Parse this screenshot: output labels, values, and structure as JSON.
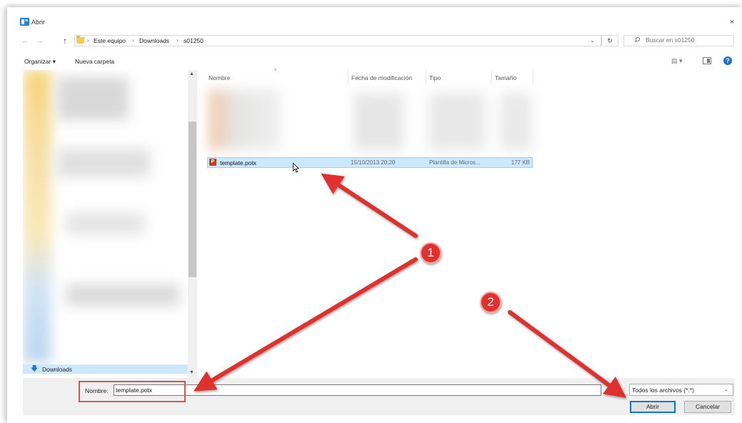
{
  "window": {
    "title": "Abrir",
    "close": "×"
  },
  "nav": {
    "back": "←",
    "forward": "→",
    "up": "↑",
    "breadcrumbs": [
      "Este equipo",
      "Downloads",
      "s01250"
    ],
    "separator": "›",
    "dropdown": "⌄",
    "refresh": "↻"
  },
  "search": {
    "placeholder": "Buscar en s01250"
  },
  "toolbar": {
    "organize": "Organizar ▾",
    "new_folder": "Nueva carpeta",
    "view": "▤ ▾",
    "help": "?"
  },
  "nav_pane": {
    "selected_item": "Downloads"
  },
  "columns": {
    "name": "Nombre",
    "modified": "Fecha de modificación",
    "type": "Tipo",
    "size": "Tamaño"
  },
  "file": {
    "name": "template.potx",
    "modified": "15/10/2013 20:20",
    "type": "Plantilla de Micros...",
    "size": "177 KB",
    "icon_letter": "P"
  },
  "bottom": {
    "name_label": "Nombre:",
    "name_value": "template.potx",
    "filter": "Todos los archivos (*.*)",
    "open": "Abrir",
    "cancel": "Cancelar"
  },
  "annotations": {
    "badge_1": "1",
    "badge_2": "2",
    "color": "#e0312f"
  },
  "colors": {
    "selection": "#cce8ff",
    "accent": "#0078d7",
    "folder": "#f5c955",
    "highlight_box": "#d9534f"
  }
}
